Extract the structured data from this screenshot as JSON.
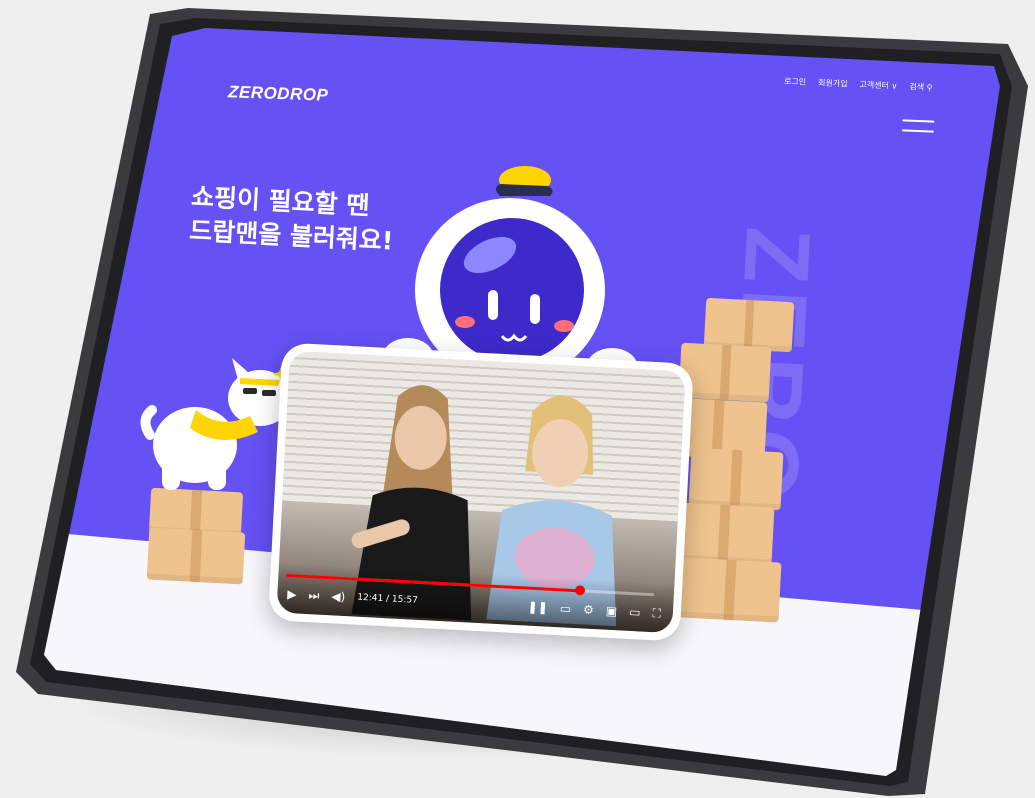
{
  "header": {
    "logo": "ZERODROP",
    "nav": [
      "로그인",
      "회원가입",
      "고객센터 ∨",
      "검색 ⚲"
    ]
  },
  "hero": {
    "headline_line1": "쇼핑이 필요할 땐",
    "headline_line2": "드랍맨을 불러줘요!",
    "watermark": "ZERO"
  },
  "video": {
    "time": "12:41 / 15:57",
    "progress": 0.8
  },
  "colors": {
    "hero_bg": "#6551f4",
    "box": "#eec38d",
    "accent_yellow": "#ffd400",
    "progress": "#ff0000"
  },
  "icons": [
    "hamburger-menu-icon",
    "play-icon",
    "next-icon",
    "volume-icon",
    "pause-icon",
    "subtitles-icon",
    "settings-icon",
    "miniplayer-icon",
    "theater-icon",
    "fullscreen-icon"
  ]
}
